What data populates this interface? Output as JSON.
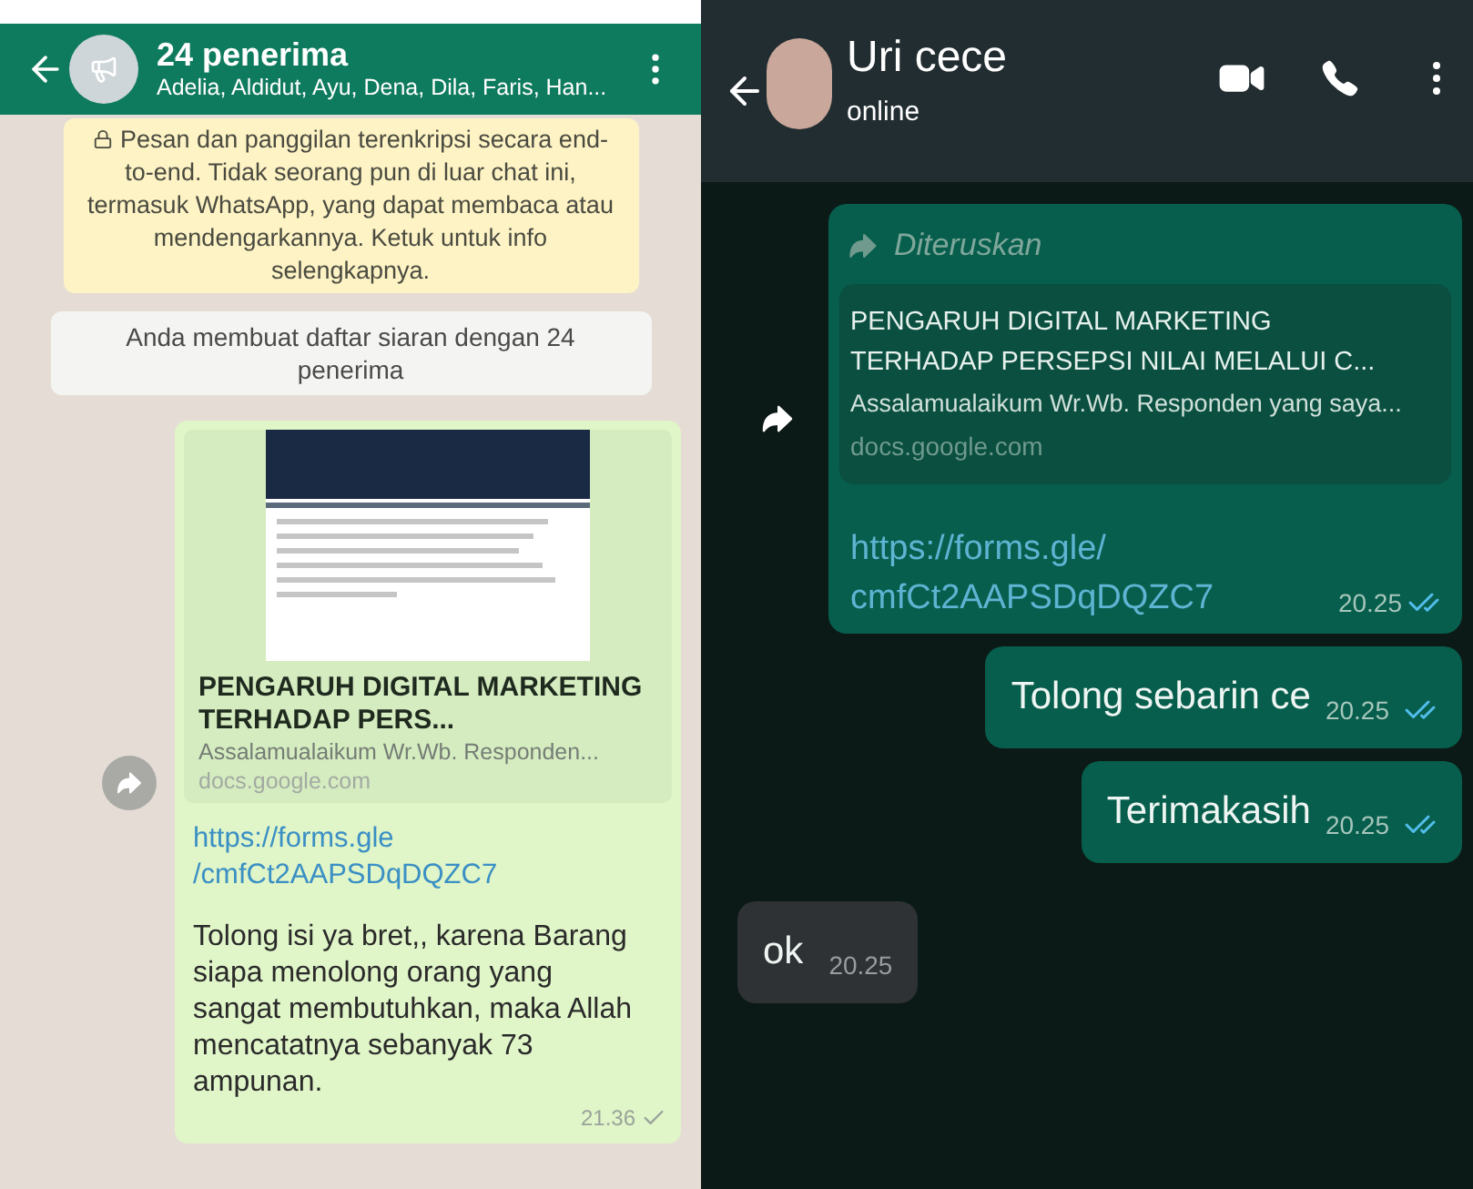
{
  "broadcast_chat": {
    "header": {
      "title": "24 penerima",
      "subtitle": "Adelia, Aldidut, Ayu, Dena, Dila, Faris, Han..."
    },
    "encryption_notice": "Pesan dan panggilan terenkripsi secara end-to-end. Tidak seorang pun di luar chat ini, termasuk WhatsApp, yang dapat membaca atau mendengarkannya. Ketuk untuk info selengkapnya.",
    "system_notice": "Anda membuat daftar siaran dengan 24 penerima",
    "messages": [
      {
        "kind": "link_preview",
        "preview_title": "PENGARUH DIGITAL MARKETING TERHADAP PERS...",
        "preview_description": "Assalamualaikum Wr.Wb. Responden...",
        "preview_domain": "docs.google.com",
        "link_lines": [
          "https://forms.gle",
          "/cmfCt2AAPSDqDQZC7"
        ],
        "text": "Tolong isi ya bret,, karena Barang siapa menolong orang yang sangat membutuhkan, maka Allah mencatatnya sebanyak 73 ampunan.",
        "time": "21.36",
        "read": false
      }
    ]
  },
  "direct_chat": {
    "header": {
      "title": "Uri cece",
      "status": "online"
    },
    "messages": [
      {
        "kind": "link_preview",
        "outgoing": true,
        "forwarded": true,
        "forwarded_label": "Diteruskan",
        "preview_title_lines": [
          "PENGARUH DIGITAL MARKETING",
          "TERHADAP PERSEPSI NILAI MELALUI C..."
        ],
        "preview_description": "Assalamualaikum Wr.Wb. Responden yang saya...",
        "preview_domain": "docs.google.com",
        "link_lines": [
          "https://forms.gle/",
          "cmfCt2AAPSDqDQZC7"
        ],
        "time": "20.25",
        "read": true
      },
      {
        "kind": "text",
        "outgoing": true,
        "text": "Tolong sebarin ce",
        "time": "20.25",
        "read": true
      },
      {
        "kind": "text",
        "outgoing": true,
        "text": "Terimakasih",
        "time": "20.25",
        "read": true
      },
      {
        "kind": "text",
        "outgoing": false,
        "text": "ok",
        "time": "20.25"
      }
    ]
  }
}
